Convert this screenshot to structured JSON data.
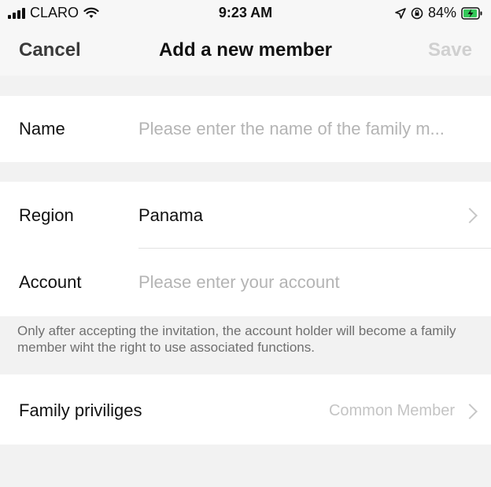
{
  "status_bar": {
    "carrier": "CLARO",
    "time": "9:23 AM",
    "battery_percent": "84%"
  },
  "nav": {
    "cancel_label": "Cancel",
    "title": "Add a new member",
    "save_label": "Save"
  },
  "form": {
    "name": {
      "label": "Name",
      "placeholder": "Please enter the name of the family m..."
    },
    "region": {
      "label": "Region",
      "value": "Panama"
    },
    "account": {
      "label": "Account",
      "placeholder": "Please enter your account"
    },
    "note": "Only after accepting the invitation, the account holder will become a family member wiht the right to use associated functions.",
    "privileges": {
      "label": "Family priviliges",
      "value": "Common Member"
    }
  },
  "colors": {
    "accent_text": "#111111",
    "placeholder": "#b4b4b4",
    "disabled": "#d0d0d0",
    "battery_green": "#34c759"
  }
}
